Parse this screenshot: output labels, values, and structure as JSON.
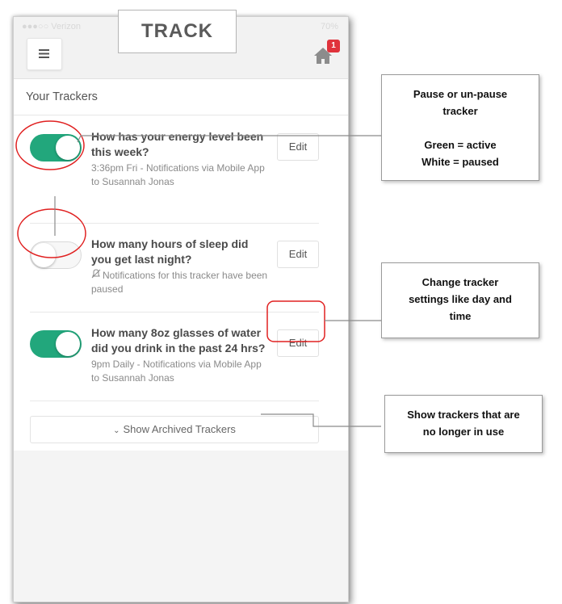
{
  "statusbar": {
    "carrier": "●●●○○ Verizon",
    "battery": "70%"
  },
  "header": {
    "notification_count": "1"
  },
  "section_title": "Your Trackers",
  "trackers": [
    {
      "title": "How has your energy level been this week?",
      "subtitle": "3:36pm Fri - Notifications via Mobile App to Susannah Jonas",
      "active": true,
      "edit_label": "Edit"
    },
    {
      "title": "How many hours of sleep did you get last night?",
      "subtitle": "Notifications for this tracker have been paused",
      "active": false,
      "edit_label": "Edit"
    },
    {
      "title": "How many 8oz glasses of water did you drink in the past 24 hrs?",
      "subtitle": "9pm Daily - Notifications via Mobile App to Susannah Jonas",
      "active": true,
      "edit_label": "Edit"
    }
  ],
  "archived_button": "Show Archived Trackers",
  "annotations": {
    "track_label": "TRACK",
    "pause_callout": {
      "line1": "Pause or un-pause",
      "line2": "tracker",
      "line3": "Green = active",
      "line4": "White = paused"
    },
    "edit_callout": {
      "line1": "Change tracker",
      "line2": "settings like day and",
      "line3": "time"
    },
    "archive_callout": {
      "line1": "Show trackers that are",
      "line2": "no longer in use"
    }
  },
  "colors": {
    "toggle_active": "#22a77c",
    "badge": "#e0333c",
    "highlight_circle": "#e02020"
  }
}
